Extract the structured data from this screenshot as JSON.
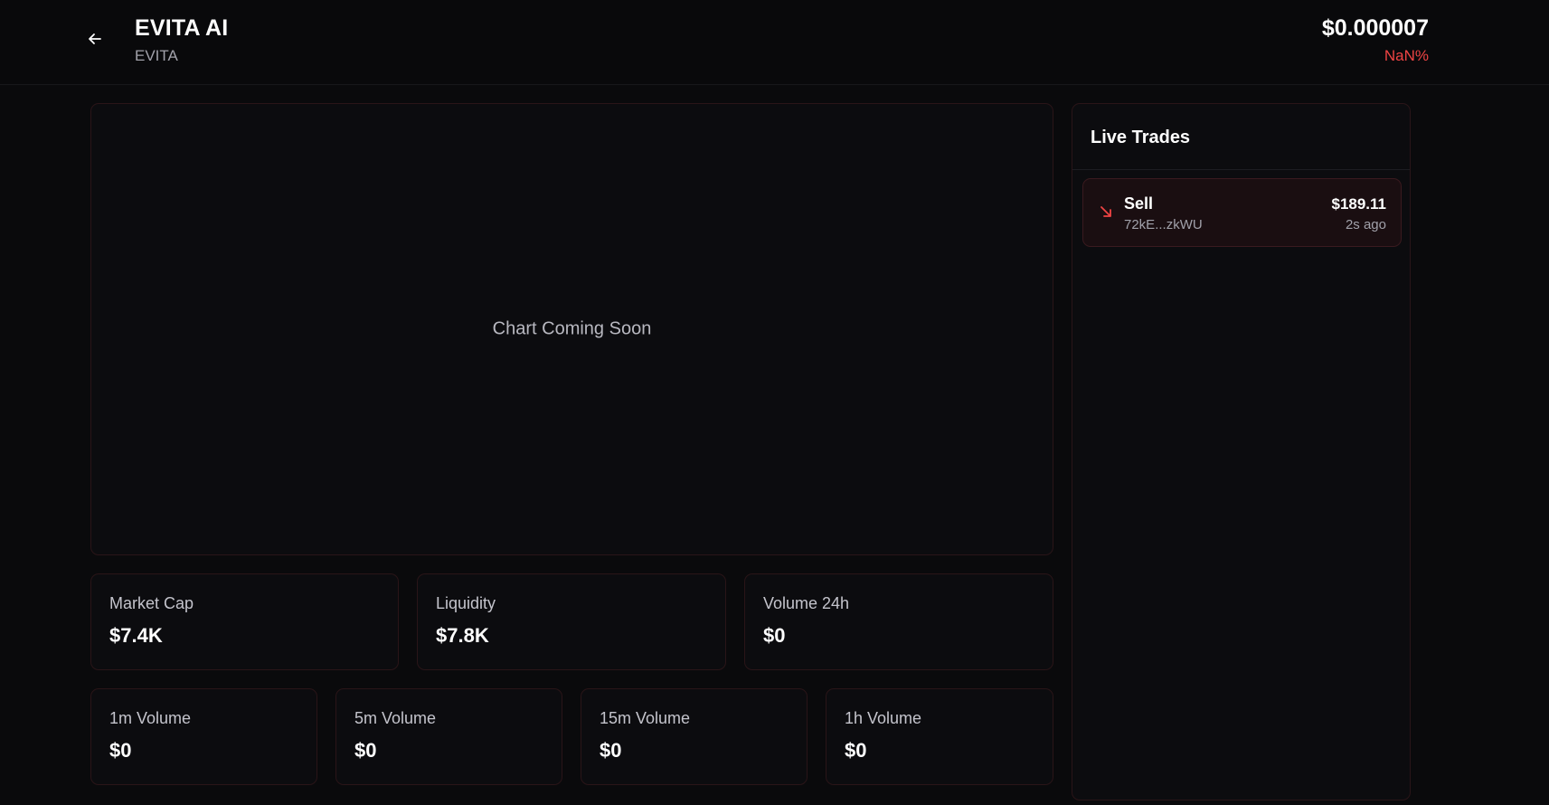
{
  "header": {
    "token_name": "EVITA AI",
    "token_symbol": "EVITA",
    "price": "$0.000007",
    "price_change": "NaN%"
  },
  "chart": {
    "placeholder": "Chart Coming Soon"
  },
  "stats_primary": [
    {
      "label": "Market Cap",
      "value": "$7.4K"
    },
    {
      "label": "Liquidity",
      "value": "$7.8K"
    },
    {
      "label": "Volume 24h",
      "value": "$0"
    }
  ],
  "stats_volume": [
    {
      "label": "1m Volume",
      "value": "$0"
    },
    {
      "label": "5m Volume",
      "value": "$0"
    },
    {
      "label": "15m Volume",
      "value": "$0"
    },
    {
      "label": "1h Volume",
      "value": "$0"
    }
  ],
  "live_trades": {
    "title": "Live Trades",
    "trades": [
      {
        "type": "Sell",
        "address": "72kE...zkWU",
        "amount": "$189.11",
        "time": "2s ago",
        "icon": "arrow-down-right-icon"
      }
    ]
  },
  "colors": {
    "background": "#0a0a0c",
    "negative": "#ef4444",
    "panel_border": "#2a1518"
  }
}
